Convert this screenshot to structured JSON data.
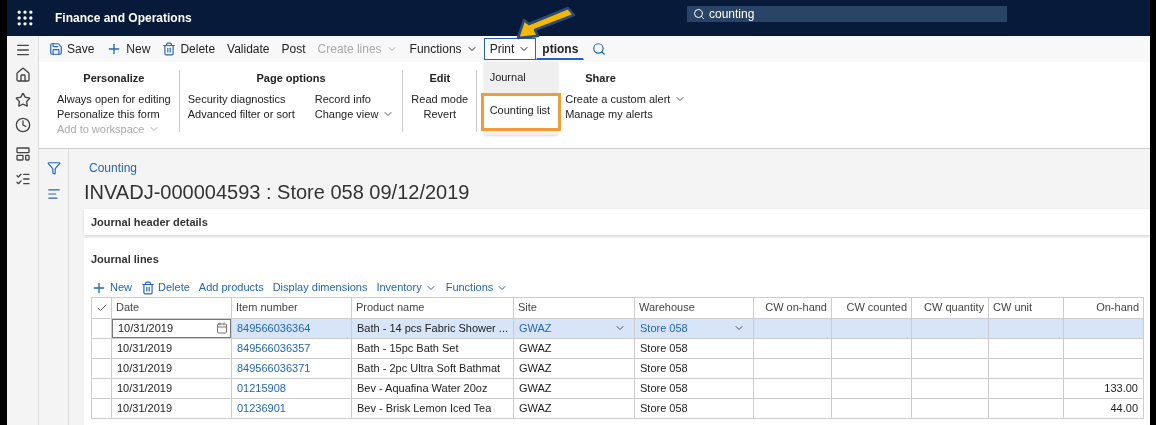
{
  "app_bar": {
    "title": "Finance and Operations",
    "search_value": "counting"
  },
  "action_bar": [
    {
      "kind": "save",
      "label": "Save",
      "disabled": false,
      "open": false,
      "selected": false
    },
    {
      "kind": "new",
      "label": "New",
      "disabled": false,
      "open": false,
      "selected": false
    },
    {
      "kind": "delete",
      "label": "Delete",
      "disabled": false,
      "open": false,
      "selected": false
    },
    {
      "kind": "plain",
      "label": "Validate",
      "disabled": false,
      "open": false,
      "selected": false
    },
    {
      "kind": "plain",
      "label": "Post",
      "disabled": false,
      "open": false,
      "selected": false
    },
    {
      "kind": "menu",
      "label": "Create lines",
      "disabled": true,
      "open": false,
      "selected": false
    },
    {
      "kind": "menu",
      "label": "Functions",
      "disabled": false,
      "open": false,
      "selected": false
    },
    {
      "kind": "menu",
      "label": "Print",
      "disabled": false,
      "open": true,
      "selected": false
    },
    {
      "kind": "plain",
      "label": "ptions",
      "disabled": false,
      "open": false,
      "selected": true
    }
  ],
  "ribbon": [
    {
      "title": "Personalize",
      "columns": [
        [
          {
            "label": "Always open for editing",
            "kind": "plain",
            "disabled": false
          },
          {
            "label": "Personalize this form",
            "kind": "plain",
            "disabled": false
          },
          {
            "label": "Add to workspace",
            "kind": "menu",
            "disabled": true
          }
        ]
      ]
    },
    {
      "title": "Page options",
      "columns": [
        [
          {
            "label": "Security diagnostics",
            "kind": "plain",
            "disabled": false
          },
          {
            "label": "Advanced filter or sort",
            "kind": "plain",
            "disabled": false
          }
        ],
        [
          {
            "label": "Record info",
            "kind": "plain",
            "disabled": false
          },
          {
            "label": "Change view",
            "kind": "menu",
            "disabled": false
          }
        ]
      ]
    },
    {
      "title": "Edit",
      "columns": [
        [
          {
            "label": "Read mode",
            "kind": "plain",
            "disabled": false
          },
          {
            "label": "Revert",
            "kind": "plain",
            "disabled": false
          }
        ]
      ]
    },
    {
      "title": "Share",
      "columns": [
        [
          {
            "label": "Create a custom alert",
            "kind": "menu",
            "disabled": false
          },
          {
            "label": "Manage my alerts",
            "kind": "plain",
            "disabled": false
          }
        ]
      ]
    }
  ],
  "print_menu": [
    {
      "label": "Journal",
      "highlighted": false
    },
    {
      "label": "Counting list",
      "highlighted": true
    }
  ],
  "breadcrumb": "Counting",
  "page_title": "INVADJ-000004593 : Store 058 09/12/2019",
  "header_section": "Journal header details",
  "lines_section": "Journal lines",
  "lines_toolbar": [
    {
      "kind": "new",
      "label": "New"
    },
    {
      "kind": "delete",
      "label": "Delete"
    },
    {
      "kind": "plain",
      "label": "Add products"
    },
    {
      "kind": "plain",
      "label": "Display dimensions"
    },
    {
      "kind": "menu",
      "label": "Inventory"
    },
    {
      "kind": "menu",
      "label": "Functions"
    }
  ],
  "table": {
    "columns": [
      {
        "label": "Date",
        "kind": "date"
      },
      {
        "label": "Item number",
        "kind": "link"
      },
      {
        "label": "Product name",
        "kind": "text"
      },
      {
        "label": "Site",
        "kind": "lookup"
      },
      {
        "label": "Warehouse",
        "kind": "lookup"
      },
      {
        "label": "CW on-hand",
        "kind": "number"
      },
      {
        "label": "CW counted",
        "kind": "number"
      },
      {
        "label": "CW quantity",
        "kind": "number"
      },
      {
        "label": "CW unit",
        "kind": "text"
      },
      {
        "label": "On-hand",
        "kind": "number"
      }
    ],
    "rows": [
      {
        "selected": true,
        "cells": [
          "10/31/2019",
          "849566036364",
          "Bath - 14 pcs Fabric Shower ...",
          "GWAZ",
          "Store 058"
        ]
      },
      {
        "selected": false,
        "cells": [
          "10/31/2019",
          "849566036357",
          "Bath - 15pc Bath Set",
          "GWAZ",
          "Store 058"
        ]
      },
      {
        "selected": false,
        "cells": [
          "10/31/2019",
          "849566036371",
          "Bath - 2pc Ultra Soft Bathmat",
          "GWAZ",
          "Store 058"
        ]
      },
      {
        "selected": false,
        "cells": [
          "10/31/2019",
          "01215908",
          "Bev - Aquafina Water 20oz",
          "GWAZ",
          "Store 058"
        ],
        "on_hand": "133.00"
      },
      {
        "selected": false,
        "cells": [
          "10/31/2019",
          "01236901",
          "Bev - Brisk Lemon Iced Tea",
          "GWAZ",
          "Store 058"
        ],
        "on_hand": "44.00"
      }
    ]
  }
}
